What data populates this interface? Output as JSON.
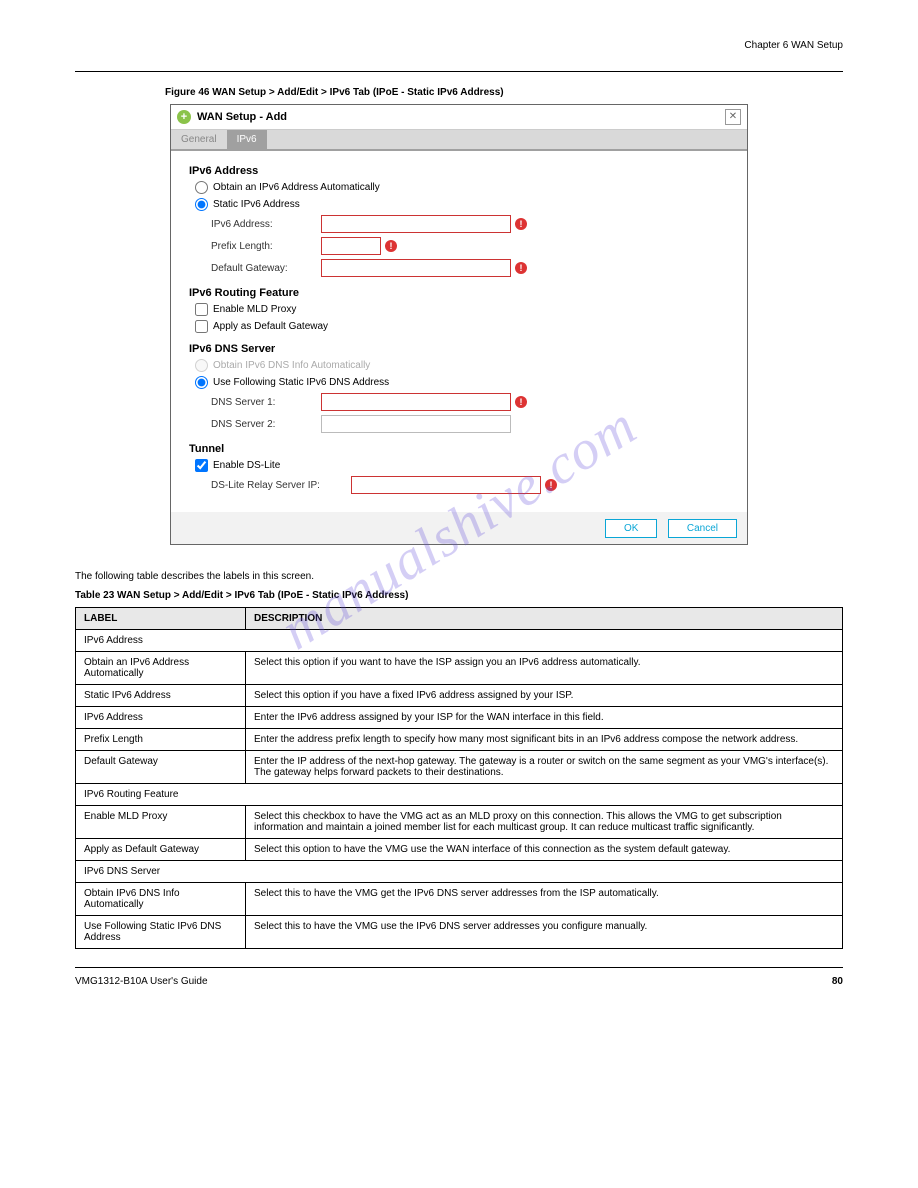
{
  "header": {
    "chapter": "Chapter 6 WAN Setup"
  },
  "figureCaption": "Figure 46   WAN Setup > Add/Edit > IPv6 Tab (IPoE - Static IPv6 Address)",
  "modal": {
    "title": "WAN Setup - Add",
    "tabs": {
      "general": "General",
      "ipv6": "IPv6"
    },
    "ipv6Address": {
      "heading": "IPv6 Address",
      "optAutomatic": "Obtain an IPv6 Address Automatically",
      "optStatic": "Static IPv6 Address",
      "ipv6AddressLabel": "IPv6 Address:",
      "prefixLengthLabel": "Prefix Length:",
      "defaultGatewayLabel": "Default Gateway:"
    },
    "routing": {
      "heading": "IPv6 Routing Feature",
      "mldProxy": "Enable MLD Proxy",
      "defaultGw": "Apply as Default Gateway"
    },
    "dns": {
      "heading": "IPv6 DNS Server",
      "optAuto": "Obtain IPv6 DNS Info Automatically",
      "optStatic": "Use Following Static IPv6 DNS Address",
      "dns1": "DNS Server 1:",
      "dns2": "DNS Server 2:"
    },
    "tunnel": {
      "heading": "Tunnel",
      "enableDsLite": "Enable DS-Lite",
      "relayLabel": "DS-Lite Relay Server IP:"
    },
    "buttons": {
      "ok": "OK",
      "cancel": "Cancel"
    }
  },
  "tableCaption": "Table 23   WAN Setup > Add/Edit > IPv6 Tab (IPoE - Static IPv6 Address)",
  "table": {
    "headers": {
      "label": "LABEL",
      "desc": "DESCRIPTION"
    },
    "rows": [
      {
        "type": "section",
        "label": "IPv6 Address"
      },
      {
        "label": "Obtain an IPv6 Address Automatically",
        "desc": "Select this option if you want to have the ISP assign you an IPv6 address automatically."
      },
      {
        "label": "Static IPv6 Address",
        "desc": "Select this option if you have a fixed IPv6 address assigned by your ISP."
      },
      {
        "label": "IPv6 Address",
        "desc": "Enter the IPv6 address assigned by your ISP for the WAN interface in this field."
      },
      {
        "label": "Prefix Length",
        "desc": "Enter the address prefix length to specify how many most significant bits in an IPv6 address compose the network address."
      },
      {
        "label": "Default Gateway",
        "desc": "Enter the IP address of the next-hop gateway. The gateway is a router or switch on the same segment as your VMG's interface(s). The gateway helps forward packets to their destinations."
      },
      {
        "type": "section",
        "label": "IPv6 Routing Feature"
      },
      {
        "label": "Enable MLD Proxy",
        "desc": "Select this checkbox to have the VMG act as an MLD proxy on this connection. This allows the VMG to get subscription information and maintain a joined member list for each multicast group. It can reduce multicast traffic significantly."
      },
      {
        "label": "Apply as Default Gateway",
        "desc": "Select this option to have the VMG use the WAN interface of this connection as the system default gateway."
      },
      {
        "type": "section",
        "label": "IPv6 DNS Server"
      },
      {
        "label": "Obtain IPv6 DNS Info Automatically",
        "desc": "Select this to have the VMG get the IPv6 DNS server addresses from the ISP automatically."
      },
      {
        "label": "Use Following Static IPv6 DNS Address",
        "desc": "Select this to have the VMG use the IPv6 DNS server addresses you configure manually."
      }
    ]
  },
  "footer": {
    "guide": "VMG1312-B10A User's Guide",
    "page": "80"
  },
  "watermark": "manualshive.com"
}
